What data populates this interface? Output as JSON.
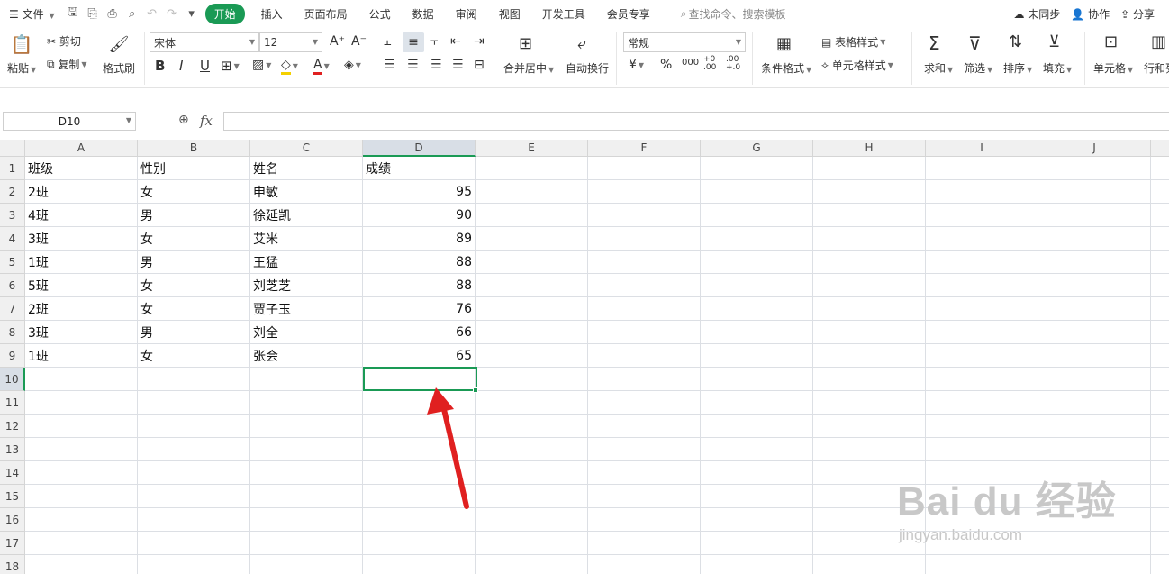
{
  "menubar": {
    "file_label": "文件",
    "tabs": [
      "开始",
      "插入",
      "页面布局",
      "公式",
      "数据",
      "审阅",
      "视图",
      "开发工具",
      "会员专享"
    ],
    "active_tab": "开始",
    "search_placeholder": "查找命令、搜索模板",
    "unsync": "未同步",
    "collab": "协作",
    "share": "分享"
  },
  "ribbon": {
    "paste": "粘贴",
    "cut": "剪切",
    "copy": "复制",
    "format_painter": "格式刷",
    "font_name": "宋体",
    "font_size": "12",
    "merge_center": "合并居中",
    "auto_wrap": "自动换行",
    "number_format": "常规",
    "conditional_format": "条件格式",
    "table_style": "表格样式",
    "cell_style": "单元格样式",
    "sum": "求和",
    "filter": "筛选",
    "sort": "排序",
    "fill": "填充",
    "cell": "单元格",
    "row_col": "行和列"
  },
  "formula_bar": {
    "name_box": "D10",
    "fx": "fx",
    "value": ""
  },
  "sheet": {
    "columns": [
      "A",
      "B",
      "C",
      "D",
      "E",
      "F",
      "G",
      "H",
      "I",
      "J"
    ],
    "rows": [
      "1",
      "2",
      "3",
      "4",
      "5",
      "6",
      "7",
      "8",
      "9",
      "10",
      "11",
      "12",
      "13",
      "14",
      "15",
      "16",
      "17",
      "18"
    ],
    "selected_cell": "D10",
    "data": [
      [
        "班级",
        "性别",
        "姓名",
        "成绩"
      ],
      [
        "2班",
        "女",
        "申敏",
        "95"
      ],
      [
        "4班",
        "男",
        "徐延凯",
        "90"
      ],
      [
        "3班",
        "女",
        "艾米",
        "89"
      ],
      [
        "1班",
        "男",
        "王猛",
        "88"
      ],
      [
        "5班",
        "女",
        "刘芝芝",
        "88"
      ],
      [
        "2班",
        "女",
        "贾子玉",
        "76"
      ],
      [
        "3班",
        "男",
        "刘全",
        "66"
      ],
      [
        "1班",
        "女",
        "张会",
        "65"
      ]
    ]
  },
  "watermark": {
    "text": "Bai du 经验",
    "url": "jingyan.baidu.com"
  },
  "colors": {
    "accent": "#1a9a55",
    "arrow": "#e02020"
  }
}
